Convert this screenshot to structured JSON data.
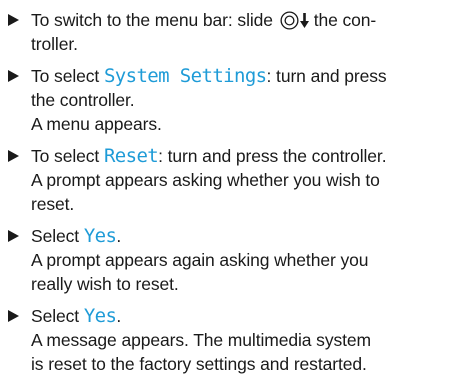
{
  "steps": [
    {
      "line1_pre": "To switch to the menu bar: slide",
      "line1_post": "the con-",
      "line2": "troller."
    },
    {
      "line1_pre": "To select",
      "highlight": "System Settings",
      "line1_post": ": turn and press",
      "line2": "the controller.",
      "result": "A menu appears."
    },
    {
      "line1_pre": "To select",
      "highlight": "Reset",
      "line1_post": ": turn and press the controller.",
      "result1": "A prompt appears asking whether you wish to",
      "result2": "reset."
    },
    {
      "line1_pre": "Select",
      "highlight": "Yes",
      "line1_post": ".",
      "result1": "A prompt appears again asking whether you",
      "result2": "really wish to reset."
    },
    {
      "line1_pre": "Select",
      "highlight": "Yes",
      "line1_post": ".",
      "result1": "A message appears. The multimedia system",
      "result2": "is reset to the factory settings and restarted."
    }
  ],
  "colors": {
    "highlight": "#1e9bd7",
    "text": "#1a1a1a"
  },
  "icons": {
    "bullet": "triangle-right-icon",
    "controller": "controller-icon",
    "slide_down": "arrow-down-icon"
  }
}
